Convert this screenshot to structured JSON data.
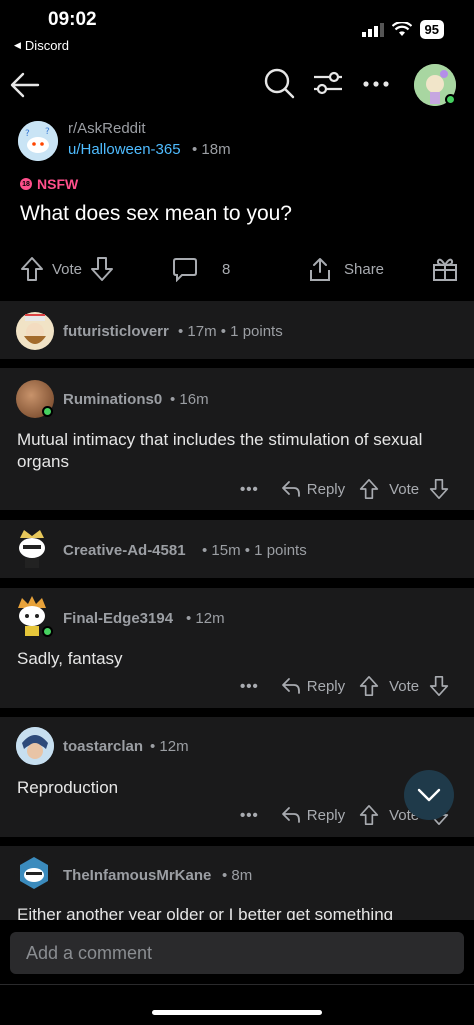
{
  "status": {
    "time": "09:02",
    "back_app": "Discord",
    "battery": "95"
  },
  "nav": {
    "back_icon": "arrow-left-icon",
    "search_icon": "search-icon",
    "sort_icon": "sort-icon",
    "more_icon": "more-horizontal-icon"
  },
  "post": {
    "subreddit": "r/AskReddit",
    "author": "u/Halloween-365",
    "age": "• 18m",
    "nsfw_label": "NSFW",
    "title": "What does sex mean to you?",
    "vote_label": "Vote",
    "comment_count": "8",
    "share_label": "Share"
  },
  "comments": [
    {
      "user": "futuristicloverr",
      "meta": "• 17m • 1 points",
      "body": ""
    },
    {
      "user": "Ruminations0",
      "meta": "• 16m",
      "body": "Mutual intimacy that includes the stimulation of sexual organs"
    },
    {
      "user": "Creative-Ad-4581",
      "meta": "• 15m • 1 points",
      "body": ""
    },
    {
      "user": "Final-Edge3194",
      "meta": "• 12m",
      "body": "Sadly, fantasy"
    },
    {
      "user": "toastarclan",
      "meta": "• 12m",
      "body": "Reproduction"
    },
    {
      "user": "TheInfamousMrKane",
      "meta": "• 8m",
      "body": "Either another year older or I better get something"
    }
  ],
  "comment_actions": {
    "more": "•••",
    "reply": "Reply",
    "vote": "Vote"
  },
  "composer": {
    "placeholder": "Add a comment"
  },
  "colors": {
    "accent_link": "#4fbcff",
    "nsfw": "#ff4f8b",
    "online": "#46d160"
  }
}
